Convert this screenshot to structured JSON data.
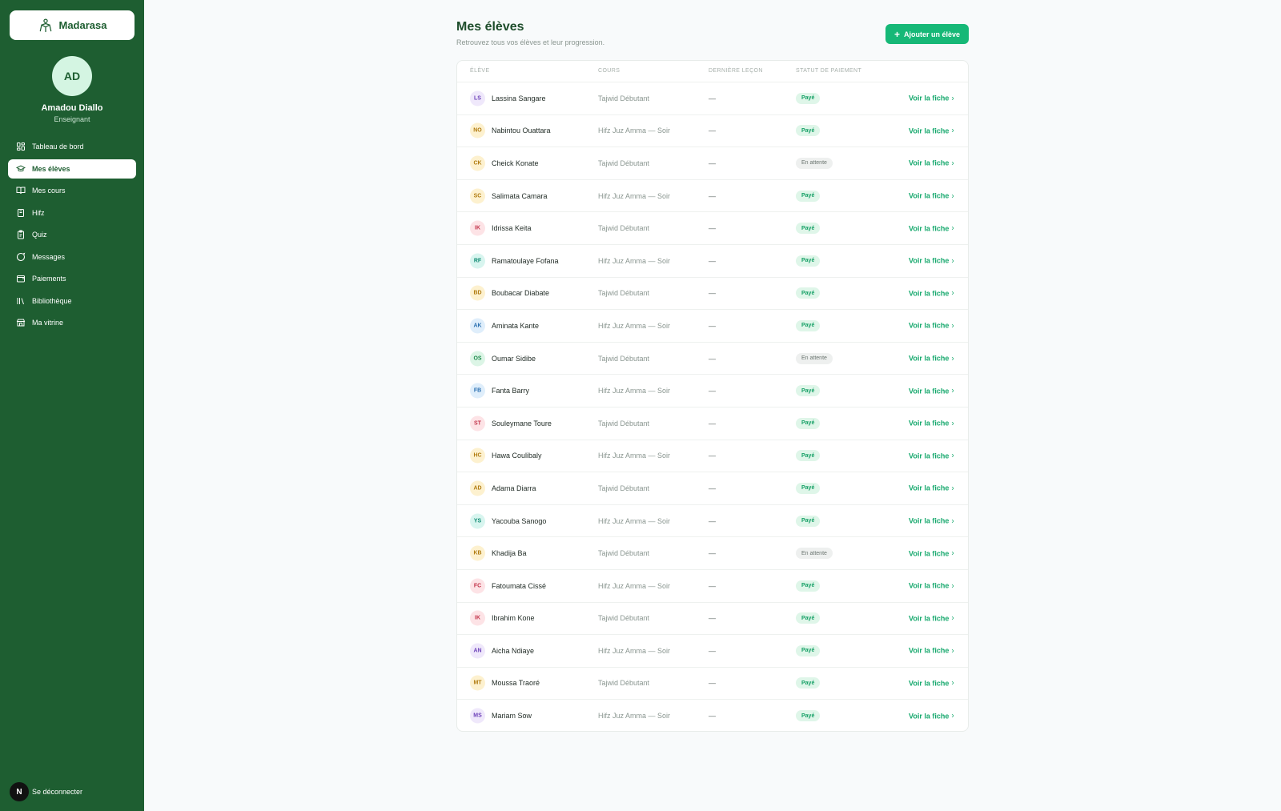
{
  "app": {
    "brand_name": "Madarasa",
    "avatar_initials": "AD",
    "user_name": "Amadou Diallo",
    "user_role": "Enseignant",
    "logout_initial": "N",
    "logout_label": "Se déconnecter"
  },
  "nav": [
    {
      "label": "Tableau de bord",
      "icon": "dashboard-icon",
      "active": false
    },
    {
      "label": "Mes élèves",
      "icon": "graduation-cap-icon",
      "active": true
    },
    {
      "label": "Mes cours",
      "icon": "book-open-icon",
      "active": false
    },
    {
      "label": "Hifz",
      "icon": "book-icon",
      "active": false
    },
    {
      "label": "Quiz",
      "icon": "clipboard-icon",
      "active": false
    },
    {
      "label": "Messages",
      "icon": "message-icon",
      "active": false
    },
    {
      "label": "Paiements",
      "icon": "wallet-icon",
      "active": false
    },
    {
      "label": "Bibliothèque",
      "icon": "library-icon",
      "active": false
    },
    {
      "label": "Ma vitrine",
      "icon": "store-icon",
      "active": false
    }
  ],
  "header": {
    "title": "Mes élèves",
    "subtitle": "Retrouvez tous vos élèves et leur progression.",
    "add_button_label": "Ajouter un élève"
  },
  "table": {
    "columns": [
      "Élève",
      "Cours",
      "Dernière leçon",
      "Statut de paiement"
    ],
    "link_label": "Voir la fiche",
    "rows": [
      {
        "initials": "LS",
        "name": "Lassina Sangare",
        "course": "Tajwid Débutant",
        "last": "—",
        "status": "Payé",
        "paid": true,
        "color": "purple"
      },
      {
        "initials": "NO",
        "name": "Nabintou Ouattara",
        "course": "Hifz Juz Amma — Soir",
        "last": "—",
        "status": "Payé",
        "paid": true,
        "color": "yellow"
      },
      {
        "initials": "CK",
        "name": "Cheick Konate",
        "course": "Tajwid Débutant",
        "last": "—",
        "status": "En attente",
        "paid": false,
        "color": "yellow"
      },
      {
        "initials": "SC",
        "name": "Salimata Camara",
        "course": "Hifz Juz Amma — Soir",
        "last": "—",
        "status": "Payé",
        "paid": true,
        "color": "yellow"
      },
      {
        "initials": "IK",
        "name": "Idrissa Keita",
        "course": "Tajwid Débutant",
        "last": "—",
        "status": "Payé",
        "paid": true,
        "color": "pink"
      },
      {
        "initials": "RF",
        "name": "Ramatoulaye Fofana",
        "course": "Hifz Juz Amma — Soir",
        "last": "—",
        "status": "Payé",
        "paid": true,
        "color": "teal"
      },
      {
        "initials": "BD",
        "name": "Boubacar Diabate",
        "course": "Tajwid Débutant",
        "last": "—",
        "status": "Payé",
        "paid": true,
        "color": "yellow"
      },
      {
        "initials": "AK",
        "name": "Aminata Kante",
        "course": "Hifz Juz Amma — Soir",
        "last": "—",
        "status": "Payé",
        "paid": true,
        "color": "blue"
      },
      {
        "initials": "OS",
        "name": "Oumar Sidibe",
        "course": "Tajwid Débutant",
        "last": "—",
        "status": "En attente",
        "paid": false,
        "color": "green"
      },
      {
        "initials": "FB",
        "name": "Fanta Barry",
        "course": "Hifz Juz Amma — Soir",
        "last": "—",
        "status": "Payé",
        "paid": true,
        "color": "blue"
      },
      {
        "initials": "ST",
        "name": "Souleymane Toure",
        "course": "Tajwid Débutant",
        "last": "—",
        "status": "Payé",
        "paid": true,
        "color": "pink"
      },
      {
        "initials": "HC",
        "name": "Hawa Coulibaly",
        "course": "Hifz Juz Amma — Soir",
        "last": "—",
        "status": "Payé",
        "paid": true,
        "color": "yellow"
      },
      {
        "initials": "AD",
        "name": "Adama Diarra",
        "course": "Tajwid Débutant",
        "last": "—",
        "status": "Payé",
        "paid": true,
        "color": "yellow"
      },
      {
        "initials": "YS",
        "name": "Yacouba Sanogo",
        "course": "Hifz Juz Amma — Soir",
        "last": "—",
        "status": "Payé",
        "paid": true,
        "color": "teal"
      },
      {
        "initials": "KB",
        "name": "Khadija Ba",
        "course": "Tajwid Débutant",
        "last": "—",
        "status": "En attente",
        "paid": false,
        "color": "yellow"
      },
      {
        "initials": "FC",
        "name": "Fatoumata Cissé",
        "course": "Hifz Juz Amma — Soir",
        "last": "—",
        "status": "Payé",
        "paid": true,
        "color": "pink"
      },
      {
        "initials": "IK",
        "name": "Ibrahim Kone",
        "course": "Tajwid Débutant",
        "last": "—",
        "status": "Payé",
        "paid": true,
        "color": "pink"
      },
      {
        "initials": "AN",
        "name": "Aicha Ndiaye",
        "course": "Hifz Juz Amma — Soir",
        "last": "—",
        "status": "Payé",
        "paid": true,
        "color": "purple"
      },
      {
        "initials": "MT",
        "name": "Moussa Traoré",
        "course": "Tajwid Débutant",
        "last": "—",
        "status": "Payé",
        "paid": true,
        "color": "yellow"
      },
      {
        "initials": "MS",
        "name": "Mariam Sow",
        "course": "Hifz Juz Amma — Soir",
        "last": "—",
        "status": "Payé",
        "paid": true,
        "color": "purple"
      }
    ]
  },
  "colors": {
    "sidebar_bg": "#1e5e31",
    "accent": "#16b877",
    "link": "#15a86c"
  }
}
